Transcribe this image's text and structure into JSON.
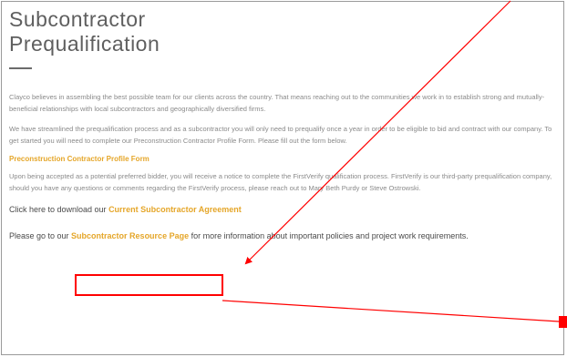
{
  "page": {
    "title_line1": "Subcontractor",
    "title_line2": "Prequalification"
  },
  "intro": {
    "para1": "Clayco believes in assembling the best possible team for our clients across the country. That means reaching out to the communities we work in to establish strong and mutually-beneficial relationships with local subcontractors and geographically diversified firms.",
    "para2": "We have streamlined the prequalification process and as a subcontractor you will only need to prequalify once a year in order to be eligible to bid and contract with our company. To get started you will need to complete our Preconstruction Contractor Profile Form. Please fill out the form below."
  },
  "form_link": {
    "label": "Preconstruction Contractor Profile Form"
  },
  "verify": {
    "para": "Upon being accepted as a potential preferred bidder, you will receive a notice to complete the FirstVerify qualification process. FirstVerify is our third-party prequalification company, should you have any questions or comments regarding the FirstVerify process, please reach out to Mary Beth Purdy or Steve Ostrowski."
  },
  "download": {
    "prefix": "Click here to download our ",
    "link_label": "Current Subcontractor Agreement"
  },
  "resource": {
    "prefix": "Please go to our ",
    "link_label": "Subcontractor Resource Page",
    "suffix": " for more information about important policies and project work requirements."
  },
  "annotation": {
    "color": "#ff0000"
  }
}
